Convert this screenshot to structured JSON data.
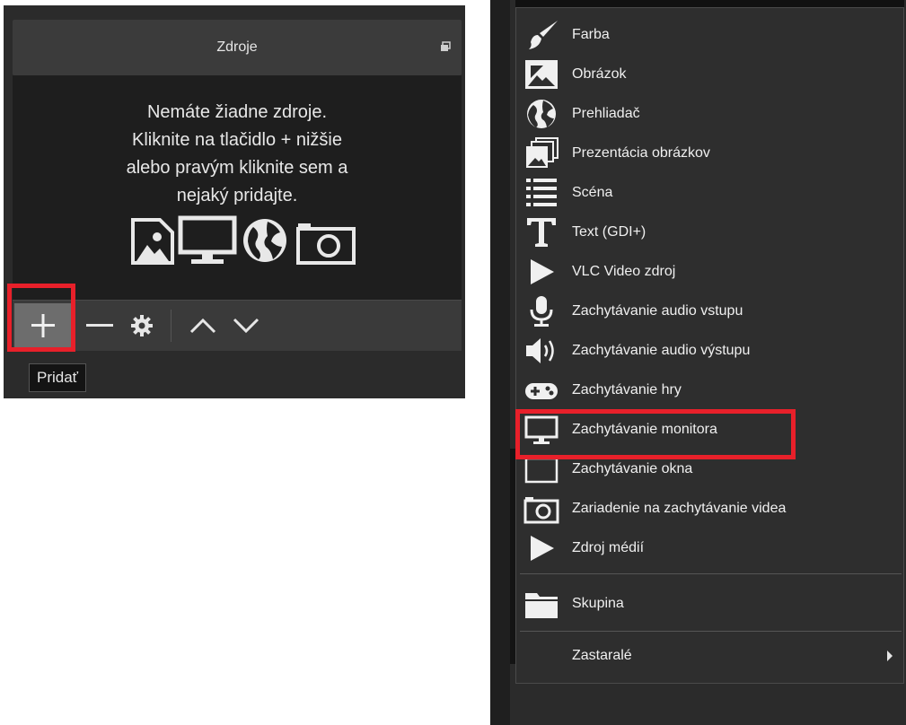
{
  "sources_panel": {
    "title": "Zdroje",
    "empty_message": [
      "Nemáte žiadne zdroje.",
      "Kliknite na tlačidlo + nižšie",
      "alebo pravým kliknite sem a",
      "nejaký pridajte."
    ],
    "empty_icons": [
      "image-icon",
      "monitor-icon",
      "globe-icon",
      "camera-icon"
    ],
    "toolbar": {
      "buttons": [
        "add-icon",
        "remove-icon",
        "gear-icon",
        "chevron-up-icon",
        "chevron-down-icon"
      ]
    },
    "tooltip": "Pridať",
    "highlight_color": "#e8202a"
  },
  "context_menu": {
    "items": [
      {
        "label": "Farba",
        "icon": "brush-icon"
      },
      {
        "label": "Obrázok",
        "icon": "image-icon"
      },
      {
        "label": "Prehliadač",
        "icon": "globe-icon"
      },
      {
        "label": "Prezentácia obrázkov",
        "icon": "slideshow-icon"
      },
      {
        "label": "Scéna",
        "icon": "list-icon"
      },
      {
        "label": "Text (GDI+)",
        "icon": "text-icon"
      },
      {
        "label": "VLC Video zdroj",
        "icon": "play-icon"
      },
      {
        "label": "Zachytávanie audio vstupu",
        "icon": "microphone-icon"
      },
      {
        "label": "Zachytávanie audio výstupu",
        "icon": "speaker-icon"
      },
      {
        "label": "Zachytávanie hry",
        "icon": "gamepad-icon"
      },
      {
        "label": "Zachytávanie monitora",
        "icon": "monitor-icon",
        "highlighted": true
      },
      {
        "label": "Zachytávanie okna",
        "icon": "window-icon"
      },
      {
        "label": "Zariadenie na zachytávanie videa",
        "icon": "camera-icon"
      },
      {
        "label": "Zdroj médií",
        "icon": "play-icon"
      },
      {
        "label": "Skupina",
        "icon": "folder-icon"
      },
      {
        "label": "Zastaralé",
        "icon": "",
        "has_submenu": true
      }
    ]
  }
}
